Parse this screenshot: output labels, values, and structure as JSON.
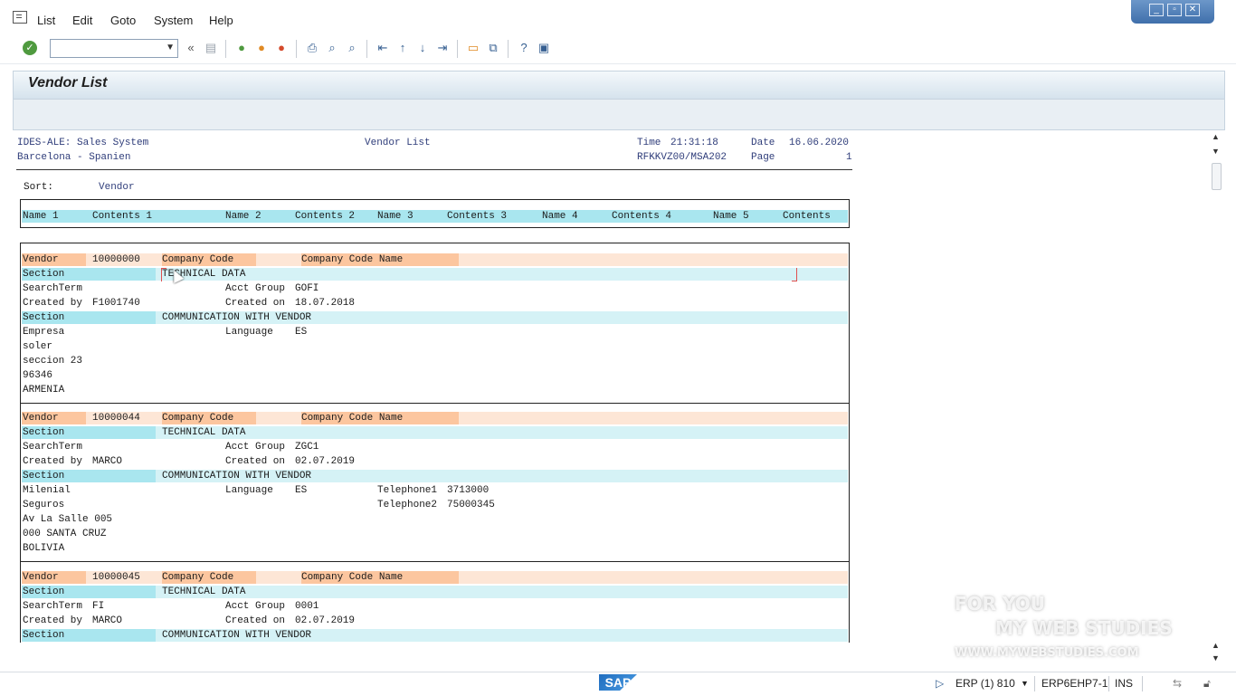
{
  "menu": {
    "items": [
      "List",
      "Edit",
      "Goto",
      "System",
      "Help"
    ]
  },
  "window_controls": [
    "minimize",
    "restore",
    "close"
  ],
  "toolbar": {
    "command_field_value": "",
    "icons": [
      "enter-icon",
      "back-arrows-icon",
      "save-icon",
      "back-icon",
      "exit-icon",
      "cancel-icon",
      "print-icon",
      "find-icon",
      "find-next-icon",
      "first-page-icon",
      "previous-page-icon",
      "next-page-icon",
      "last-page-icon",
      "create-session-icon",
      "shortcut-icon",
      "help-icon",
      "customize-layout-icon"
    ]
  },
  "title": "Vendor List",
  "report_header": {
    "left1": "IDES-ALE: Sales System",
    "left2": "Barcelona - Spanien",
    "center": "Vendor List",
    "time_label": "Time",
    "time": "21:31:18",
    "date_label": "Date",
    "date": "16.06.2020",
    "program": "RFKKVZ00/MSA202",
    "page_label": "Page",
    "page": "1"
  },
  "sort": {
    "label": "Sort:",
    "value": "Vendor"
  },
  "columns": [
    "Name 1",
    "Contents 1",
    "Name 2",
    "Contents 2",
    "Name 3",
    "Contents 3",
    "Name 4",
    "Contents 4",
    "Name 5",
    "Contents"
  ],
  "labels": {
    "vendor": "Vendor",
    "company_code": "Company Code",
    "company_code_name": "Company Code Name",
    "section": "Section",
    "technical_data": "TECHNICAL DATA",
    "communication": "COMMUNICATION WITH VENDOR",
    "search_term": "SearchTerm",
    "acct_group": "Acct Group",
    "created_by": "Created by",
    "created_on": "Created on",
    "language": "Language",
    "telephone1": "Telephone1",
    "telephone2": "Telephone2"
  },
  "vendors": [
    {
      "number": "10000000",
      "search_term": "",
      "acct_group": "GOFI",
      "created_by": "F1001740",
      "created_on": "18.07.2018",
      "language": "ES",
      "telephone1": "",
      "telephone2": "",
      "address": [
        "Empresa",
        "soler",
        "seccion 23",
        "96346",
        "ARMENIA"
      ]
    },
    {
      "number": "10000044",
      "search_term": "",
      "acct_group": "ZGC1",
      "created_by": "MARCO",
      "created_on": "02.07.2019",
      "language": "ES",
      "telephone1": "3713000",
      "telephone2": "75000345",
      "address": [
        "Milenial",
        "Seguros",
        "Av La Salle 005",
        "000 SANTA CRUZ",
        "BOLIVIA"
      ]
    },
    {
      "number": "10000045",
      "search_term": "FI",
      "acct_group": "0001",
      "created_by": "MARCO",
      "created_on": "02.07.2019",
      "language": "",
      "telephone1": "",
      "telephone2": "",
      "address": []
    }
  ],
  "status": {
    "system": "ERP (1) 810",
    "server": "ERP6EHP7-1",
    "mode": "INS"
  },
  "sap_logo": "SAP",
  "watermark": {
    "line1": "FOR YOU",
    "line2": "MY WEB STUDIES",
    "line3": "WWW.MYWEBSTUDIES.COM"
  },
  "colors": {
    "header_cyan": "#a9e6ef",
    "vendor_orange": "#fcc69f",
    "title_band": "#d6e3ed"
  }
}
